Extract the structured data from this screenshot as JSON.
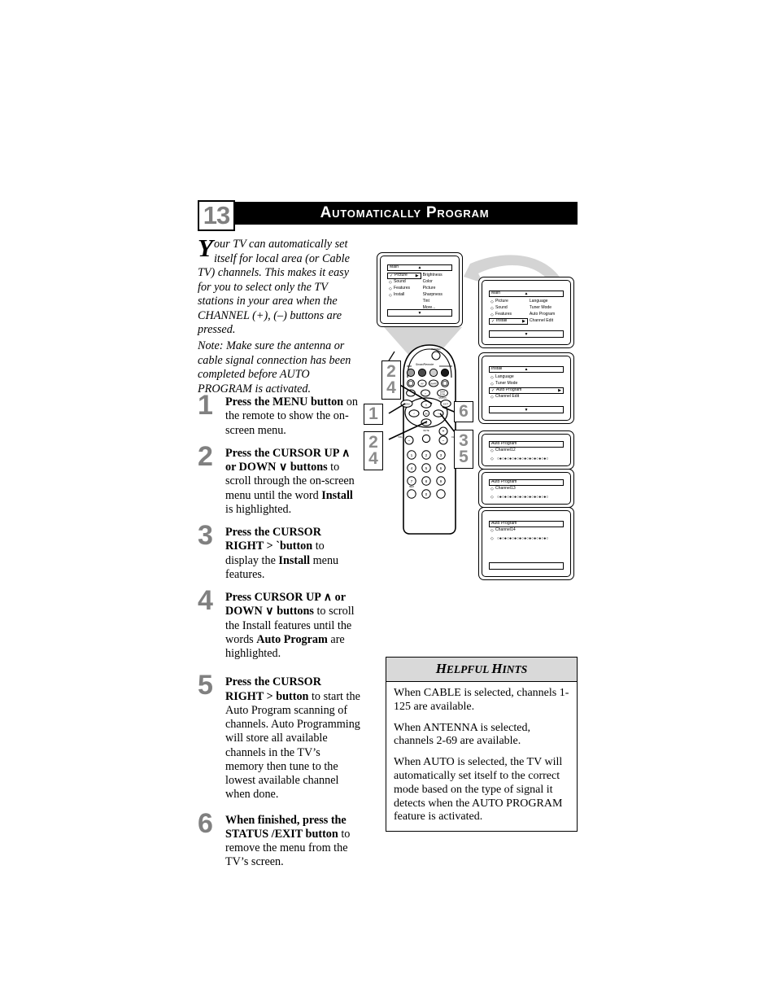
{
  "page": {
    "chapter_number": "13",
    "title": "Automatically Program"
  },
  "intro": {
    "dropcap": "Y",
    "text": "our TV can automatically set itself for local area (or Cable TV) channels. This makes it easy for you to select only the TV stations in your area when the CHANNEL (+), (–) buttons are pressed."
  },
  "note": {
    "text": "Note: Make sure the antenna or cable signal connection has been completed before AUTO PROGRAM is activated."
  },
  "steps": [
    {
      "number": "1",
      "bold_lead": "Press the MENU button",
      "rest": " on the remote to show the on-screen menu."
    },
    {
      "number": "2",
      "bold_lead": "Press the CURSOR UP ∧ or DOWN ∨ buttons",
      "rest": " to scroll through the on-screen menu until the word ",
      "bold_mid": "Install",
      "rest2": " is highlighted."
    },
    {
      "number": "3",
      "bold_lead": "Press the CURSOR RIGHT > `button",
      "rest": " to display the ",
      "bold_mid": "Install",
      "rest2": " menu features."
    },
    {
      "number": "4",
      "bold_lead": "Press CURSOR UP ∧ or DOWN ∨ buttons",
      "rest": " to scroll the Install features until the words ",
      "bold_mid": "Auto Program",
      "rest2": " are highlighted."
    },
    {
      "number": "5",
      "bold_lead": "Press the CURSOR RIGHT > button",
      "rest": " to start the Auto Program scanning of channels. Auto Programming will store all available channels in the TV’s memory then tune to the lowest available channel when done."
    },
    {
      "number": "6",
      "bold_lead": "When finished, press the STATUS /EXIT button",
      "rest": " to remove the menu from the TV’s screen."
    }
  ],
  "hints": {
    "title_a": "H",
    "title_b": "ELPFUL ",
    "title_c": "H",
    "title_d": "INTS",
    "title_full": "Helpful Hints",
    "items": [
      "When CABLE is selected, channels 1-125 are available.",
      "When ANTENNA is selected, channels 2-69 are available.",
      "When AUTO is selected, the TV will automatically set itself to the correct mode based on the type of signal it detects when the AUTO PROGRAM feature is activated."
    ]
  },
  "screens": {
    "main_picture": {
      "header": "Main",
      "header_arrow": "▲",
      "left_items": [
        {
          "label": "Picture",
          "bullet": "✓",
          "selected": true,
          "arrow": "▶"
        },
        {
          "label": "Sound",
          "bullet": "◇",
          "selected": false
        },
        {
          "label": "Features",
          "bullet": "◇",
          "selected": false
        },
        {
          "label": "Install",
          "bullet": "◇",
          "selected": false
        }
      ],
      "right_items": [
        "Brightness",
        "Color",
        "Picture",
        "Sharpness",
        "Tint",
        "More..."
      ],
      "bottom_arrow": "▼"
    },
    "main_install": {
      "header": "Main",
      "header_arrow": "▲",
      "left_items": [
        {
          "label": "Picture",
          "bullet": "◇",
          "selected": false
        },
        {
          "label": "Sound",
          "bullet": "◇",
          "selected": false
        },
        {
          "label": "Features",
          "bullet": "◇",
          "selected": false
        },
        {
          "label": "Install",
          "bullet": "✓",
          "selected": true,
          "arrow": "▶"
        }
      ],
      "right_items": [
        "Language",
        "Tuner Mode",
        "Auto Program",
        "Channel Edit"
      ],
      "bottom_arrow": "▼"
    },
    "install_menu": {
      "header": "Install",
      "header_arrow": "▲",
      "left_items": [
        {
          "label": "Language",
          "bullet": "◇",
          "selected": false
        },
        {
          "label": "Tuner Mode",
          "bullet": "◇",
          "selected": false
        },
        {
          "label": "Auto Program",
          "bullet": "✓",
          "selected": true,
          "arrow": "▶"
        },
        {
          "label": "Channel Edit",
          "bullet": "◇",
          "selected": false
        }
      ],
      "right_items": [],
      "bottom_arrow": "▼"
    },
    "auto_program_1": {
      "header": "Auto Program",
      "row_label": "Channel",
      "row_bullet": "◇",
      "channel": "12",
      "dots": "○●○●○●○●○●○●○●○●○●○●○",
      "dots_bullet": "◇"
    },
    "auto_program_2": {
      "header": "Auto Program",
      "row_label": "Channel",
      "row_bullet": "◇",
      "channel": "13",
      "dots": "○●○●○●○●○●○●○●○●○●○●○",
      "dots_bullet": "◇"
    },
    "auto_program_3": {
      "header": "Auto Program",
      "row_label": "Channel",
      "row_bullet": "◇",
      "channel": "14",
      "dots": "○●○●○●○●○●○●○●○●○●○●○",
      "dots_bullet": "◇"
    }
  },
  "remote": {
    "brand": "SmartRemote",
    "power_label": "POWER",
    "menu_label": "MENU",
    "exit_label": "EXIT",
    "ok_label": "OK",
    "status_label": "STATUS",
    "vol_label": "VOL",
    "ch_label": "CH",
    "mute_label": "MUTE",
    "keypad": [
      "1",
      "2",
      "3",
      "4",
      "5",
      "6",
      "7",
      "8",
      "9",
      "0"
    ],
    "keypad_extra": "HELP"
  },
  "callouts": [
    {
      "id": "callout-24-top",
      "lines": [
        "2",
        "4"
      ]
    },
    {
      "id": "callout-1",
      "lines": [
        "1"
      ]
    },
    {
      "id": "callout-24-bottom",
      "lines": [
        "2",
        "4"
      ]
    },
    {
      "id": "callout-6",
      "lines": [
        "6"
      ]
    },
    {
      "id": "callout-35",
      "lines": [
        "3",
        "5"
      ]
    }
  ],
  "colors": {
    "accent_gray": "#808080",
    "header_bar": "#000000",
    "hints_header_bg": "#d9d9d9",
    "funnel_gray": "#d4d4d4"
  }
}
